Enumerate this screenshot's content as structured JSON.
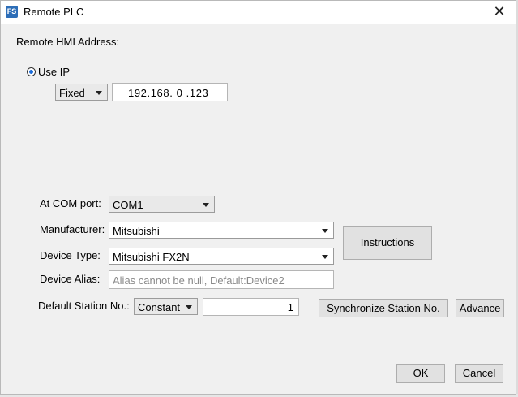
{
  "dialog": {
    "title": "Remote PLC",
    "app_icon_text": "FS",
    "close_icon": "close-icon"
  },
  "hmi": {
    "section_label": "Remote HMI Address:",
    "use_ip_label": "Use IP",
    "use_ip_selected": true,
    "ip_mode": "Fixed",
    "ip_address": "192.168. 0 .123"
  },
  "plc": {
    "com_port_label": "At COM port:",
    "com_port_value": "COM1",
    "manufacturer_label": "Manufacturer:",
    "manufacturer_value": "Mitsubishi",
    "device_type_label": "Device Type:",
    "device_type_value": "Mitsubishi FX2N",
    "device_alias_label": "Device Alias:",
    "device_alias_placeholder": "Alias cannot be null, Default:Device2",
    "station_label": "Default Station No.:",
    "station_mode": "Constant",
    "station_value": "1"
  },
  "buttons": {
    "instructions": "Instructions",
    "synchronize": "Synchronize Station No.",
    "advance": "Advance",
    "ok": "OK",
    "cancel": "Cancel"
  }
}
